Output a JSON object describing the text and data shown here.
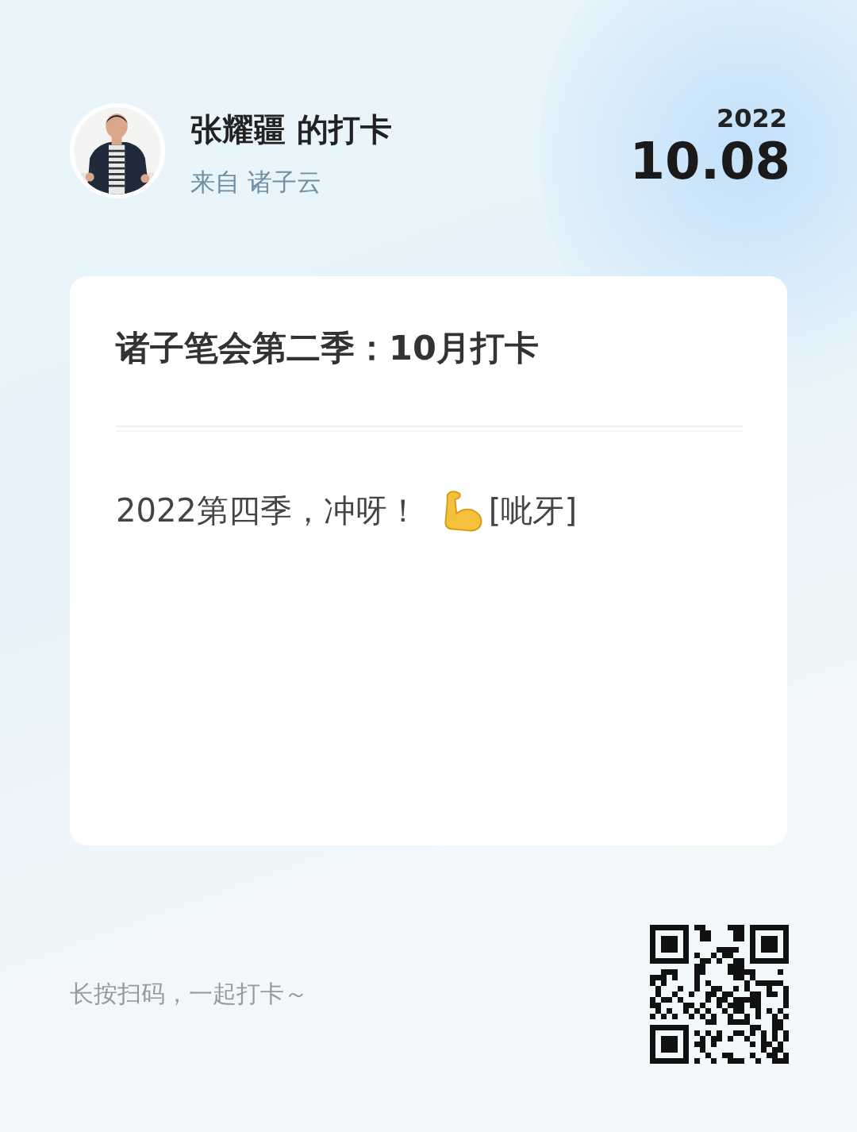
{
  "header": {
    "user_name": "张耀疆 的打卡",
    "source": "来自 诸子云",
    "year": "2022",
    "date": "10.08"
  },
  "card": {
    "title": "诸子笔会第二季：10月打卡",
    "post_text": "2022第四季，冲呀！",
    "emoticon_code": "[呲牙]"
  },
  "footer": {
    "hint": "长按扫码，一起打卡～"
  }
}
